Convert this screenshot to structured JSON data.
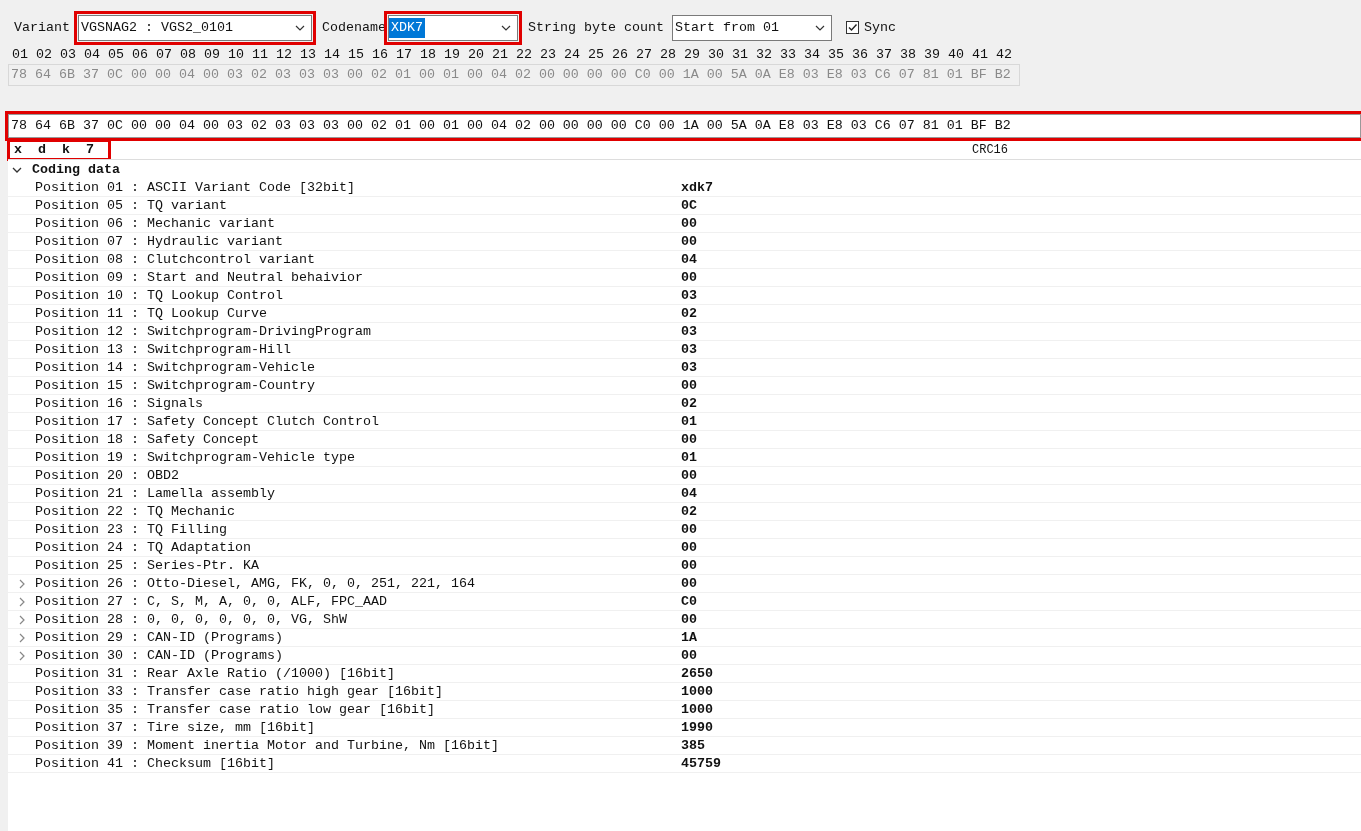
{
  "toolbar": {
    "variant_label": "Variant",
    "variant": {
      "value": "VGSNAG2 : VGS2_0101",
      "highlighted": true
    },
    "codename_label": "Codename",
    "codename": {
      "value": "XDK7",
      "highlighted": true,
      "text_selected": true
    },
    "byte_count_label": "String byte count",
    "byte_count": {
      "value": "Start from 01"
    },
    "sync": {
      "label": "Sync",
      "checked": true
    }
  },
  "positions": [
    "01",
    "02",
    "03",
    "04",
    "05",
    "06",
    "07",
    "08",
    "09",
    "10",
    "11",
    "12",
    "13",
    "14",
    "15",
    "16",
    "17",
    "18",
    "19",
    "20",
    "21",
    "22",
    "23",
    "24",
    "25",
    "26",
    "27",
    "28",
    "29",
    "30",
    "31",
    "32",
    "33",
    "34",
    "35",
    "36",
    "37",
    "38",
    "39",
    "40",
    "41",
    "42"
  ],
  "hex_readonly": "78 64 6B 37 0C 00 00 04 00 03 02 03 03 03 00 02 01 00 01 00 04 02 00 00 00 00 C0 00 1A 00 5A 0A E8 03 E8 03 C6 07 81 01 BF B2",
  "hex_field": {
    "value": "78 64 6B 37 0C 00 00 04 00 03 02 03 03 03 00 02 01 00 01 00 04 02 00 00 00 00 C0 00 1A 00 5A 0A E8 03 E8 03 C6 07 81 01 BF B2",
    "highlighted": true
  },
  "ascii": {
    "chars": [
      "x",
      "d",
      "k",
      "7"
    ],
    "highlighted": true,
    "crc_label": "CRC16"
  },
  "tree": {
    "label": "Coding data",
    "expanded": true,
    "children": [
      {
        "label": "Position 01 : ASCII Variant Code [32bit]",
        "value": "xdk7",
        "expandable": false
      },
      {
        "label": "Position 05 : TQ variant",
        "value": "0C",
        "expandable": false
      },
      {
        "label": "Position 06 : Mechanic variant",
        "value": "00",
        "expandable": false
      },
      {
        "label": "Position 07 : Hydraulic variant",
        "value": "00",
        "expandable": false
      },
      {
        "label": "Position 08 : Clutchcontrol variant",
        "value": "04",
        "expandable": false
      },
      {
        "label": "Position 09 : Start and Neutral behaivior",
        "value": "00",
        "expandable": false
      },
      {
        "label": "Position 10 : TQ Lookup Control",
        "value": "03",
        "expandable": false
      },
      {
        "label": "Position 11 : TQ Lookup Curve",
        "value": "02",
        "expandable": false
      },
      {
        "label": "Position 12 : Switchprogram-DrivingProgram",
        "value": "03",
        "expandable": false
      },
      {
        "label": "Position 13 : Switchprogram-Hill",
        "value": "03",
        "expandable": false
      },
      {
        "label": "Position 14 : Switchprogram-Vehicle",
        "value": "03",
        "expandable": false
      },
      {
        "label": "Position 15 : Switchprogram-Country",
        "value": "00",
        "expandable": false
      },
      {
        "label": "Position 16 : Signals",
        "value": "02",
        "expandable": false
      },
      {
        "label": "Position 17 : Safety Concept Clutch Control",
        "value": "01",
        "expandable": false
      },
      {
        "label": "Position 18 : Safety Concept",
        "value": "00",
        "expandable": false
      },
      {
        "label": "Position 19 : Switchprogram-Vehicle type",
        "value": "01",
        "expandable": false
      },
      {
        "label": "Position 20 : OBD2",
        "value": "00",
        "expandable": false
      },
      {
        "label": "Position 21 : Lamella assembly",
        "value": "04",
        "expandable": false
      },
      {
        "label": "Position 22 : TQ Mechanic",
        "value": "02",
        "expandable": false
      },
      {
        "label": "Position 23 : TQ Filling",
        "value": "00",
        "expandable": false
      },
      {
        "label": "Position 24 : TQ Adaptation",
        "value": "00",
        "expandable": false
      },
      {
        "label": "Position 25 : Series-Ptr. KA",
        "value": "00",
        "expandable": false
      },
      {
        "label": "Position 26 : Otto-Diesel, AMG, FK, 0, 0, 251, 221, 164",
        "value": "00",
        "expandable": true
      },
      {
        "label": "Position 27 : C, S, M, A, 0, 0, ALF, FPC_AAD",
        "value": "C0",
        "expandable": true
      },
      {
        "label": "Position 28 : 0, 0, 0, 0, 0, 0, VG, ShW",
        "value": "00",
        "expandable": true
      },
      {
        "label": "Position 29 : CAN-ID (Programs)",
        "value": "1A",
        "expandable": true
      },
      {
        "label": "Position 30 : CAN-ID (Programs)",
        "value": "00",
        "expandable": true
      },
      {
        "label": "Position 31 : Rear Axle Ratio (/1000) [16bit]",
        "value": "2650",
        "expandable": false
      },
      {
        "label": "Position 33 : Transfer case ratio high gear [16bit]",
        "value": "1000",
        "expandable": false
      },
      {
        "label": "Position 35 : Transfer case ratio low gear [16bit]",
        "value": "1000",
        "expandable": false
      },
      {
        "label": "Position 37 : Tire size, mm [16bit]",
        "value": "1990",
        "expandable": false
      },
      {
        "label": "Position 39 : Moment inertia Motor and Turbine, Nm [16bit]",
        "value": "385",
        "expandable": false
      },
      {
        "label": "Position 41 : Checksum [16bit]",
        "value": "45759",
        "expandable": false
      }
    ]
  }
}
